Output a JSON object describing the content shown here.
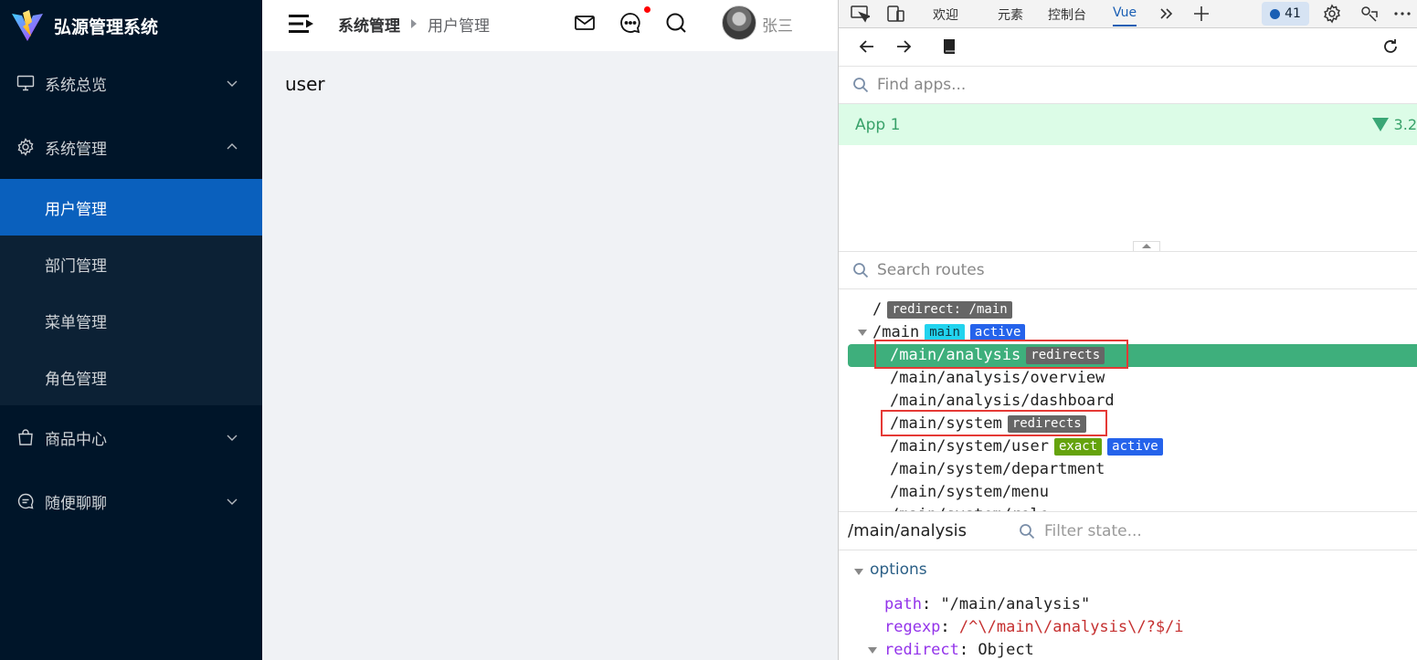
{
  "app": {
    "title": "弘源管理系统",
    "menu": [
      {
        "label": "系统总览",
        "icon": "monitor-icon",
        "expanded": false
      },
      {
        "label": "系统管理",
        "icon": "gear-icon",
        "expanded": true,
        "children": [
          "用户管理",
          "部门管理",
          "菜单管理",
          "角色管理"
        ],
        "active_child": 0
      },
      {
        "label": "商品中心",
        "icon": "shopping-bag-icon",
        "expanded": false
      },
      {
        "label": "随便聊聊",
        "icon": "chat-icon",
        "expanded": false
      }
    ],
    "breadcrumb": [
      "系统管理",
      "用户管理"
    ],
    "user_name": "张三",
    "content": "user"
  },
  "devtools": {
    "tabs": [
      "欢迎",
      "元素",
      "控制台",
      "Vue"
    ],
    "active_tab": "Vue",
    "message_count": "41",
    "find_apps_placeholder": "Find apps...",
    "app_name": "App 1",
    "app_version": "3.2",
    "search_routes_placeholder": "Search routes",
    "routes": [
      {
        "path": "/",
        "tags": [
          {
            "text": "redirect: /main",
            "color": "gray"
          }
        ]
      },
      {
        "path": "/main",
        "tags": [
          {
            "text": "main",
            "color": "cyan"
          },
          {
            "text": "active",
            "color": "blue"
          }
        ]
      },
      {
        "path": "/main/analysis",
        "tags": [
          {
            "text": "redirects",
            "color": "gray"
          }
        ],
        "selected": true
      },
      {
        "path": "/main/analysis/overview",
        "tags": []
      },
      {
        "path": "/main/analysis/dashboard",
        "tags": []
      },
      {
        "path": "/main/system",
        "tags": [
          {
            "text": "redirects",
            "color": "gray"
          }
        ]
      },
      {
        "path": "/main/system/user",
        "tags": [
          {
            "text": "exact",
            "color": "green"
          },
          {
            "text": "active",
            "color": "blue"
          }
        ]
      },
      {
        "path": "/main/system/department",
        "tags": []
      },
      {
        "path": "/main/system/menu",
        "tags": []
      },
      {
        "path": "/main/system/role",
        "tags": []
      }
    ],
    "selected_route": "/main/analysis",
    "filter_state_placeholder": "Filter state...",
    "state_section": "options",
    "state": {
      "path_key": "path",
      "path_value": "\"/main/analysis\"",
      "regexp_key": "regexp",
      "regexp_value": "/^\\/main\\/analysis\\/?$/i",
      "redirect_key": "redirect",
      "redirect_value": "Object"
    }
  },
  "colors": {
    "sidebar_bg": "#001529",
    "menu_active": "#0a60bd",
    "route_selected": "#3eaf7c",
    "highlight_box": "#e53935"
  }
}
